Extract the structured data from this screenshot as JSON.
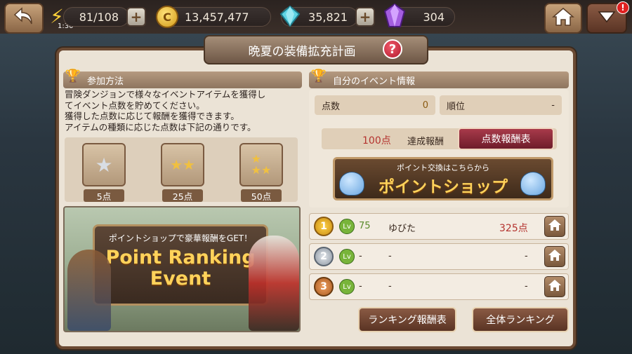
{
  "topbar": {
    "stamina": "81/108",
    "stamina_timer": "1:30",
    "gold": "13,457,477",
    "crystal": "35,821",
    "gem": "304"
  },
  "window": {
    "title": "晩夏の装備拡充計画"
  },
  "left": {
    "header": "参加方法",
    "description": [
      "冒険ダンジョンで様々なイベントアイテムを獲得し",
      "てイベント点数を貯めてください。",
      "獲得した点数に応じて報酬を獲得できます。",
      "アイテムの種類に応じた点数は下記の通りです。"
    ],
    "items": [
      {
        "label": "5点"
      },
      {
        "label": "25点"
      },
      {
        "label": "50点"
      }
    ],
    "banner": {
      "subtitle": "ポイントショップで豪華報酬をGET！",
      "title_line1": "Point Ranking",
      "title_line2": "Event"
    }
  },
  "right": {
    "header": "自分のイベント情報",
    "score_label": "点数",
    "score_value": "0",
    "rank_label": "順位",
    "rank_value": "-",
    "reward_points": "100点",
    "reward_label": "達成報酬",
    "points_table_button": "点数報酬表",
    "shop_caption": "ポイント交換はこちらから",
    "shop_title": "ポイントショップ",
    "ranking": [
      {
        "rank": "1",
        "lv": "75",
        "name": "ゆびた",
        "score": "325点"
      },
      {
        "rank": "2",
        "lv": "-",
        "name": "-",
        "score": "-"
      },
      {
        "rank": "3",
        "lv": "-",
        "name": "-",
        "score": "-"
      }
    ],
    "ranking_reward_button": "ランキング報酬表",
    "all_ranking_button": "全体ランキング"
  },
  "colors": {
    "accent_red": "#8e2a3a",
    "score_red": "#b4322e",
    "gold": "#e8b430"
  },
  "icons": [
    "back-arrow-icon",
    "lightning-icon",
    "gold-coin-icon",
    "crystal-icon",
    "gem-icon",
    "home-icon",
    "dropdown-icon",
    "help-icon",
    "trophy-icon",
    "star-icon",
    "slime-icon",
    "lv-icon",
    "medal-icon"
  ]
}
